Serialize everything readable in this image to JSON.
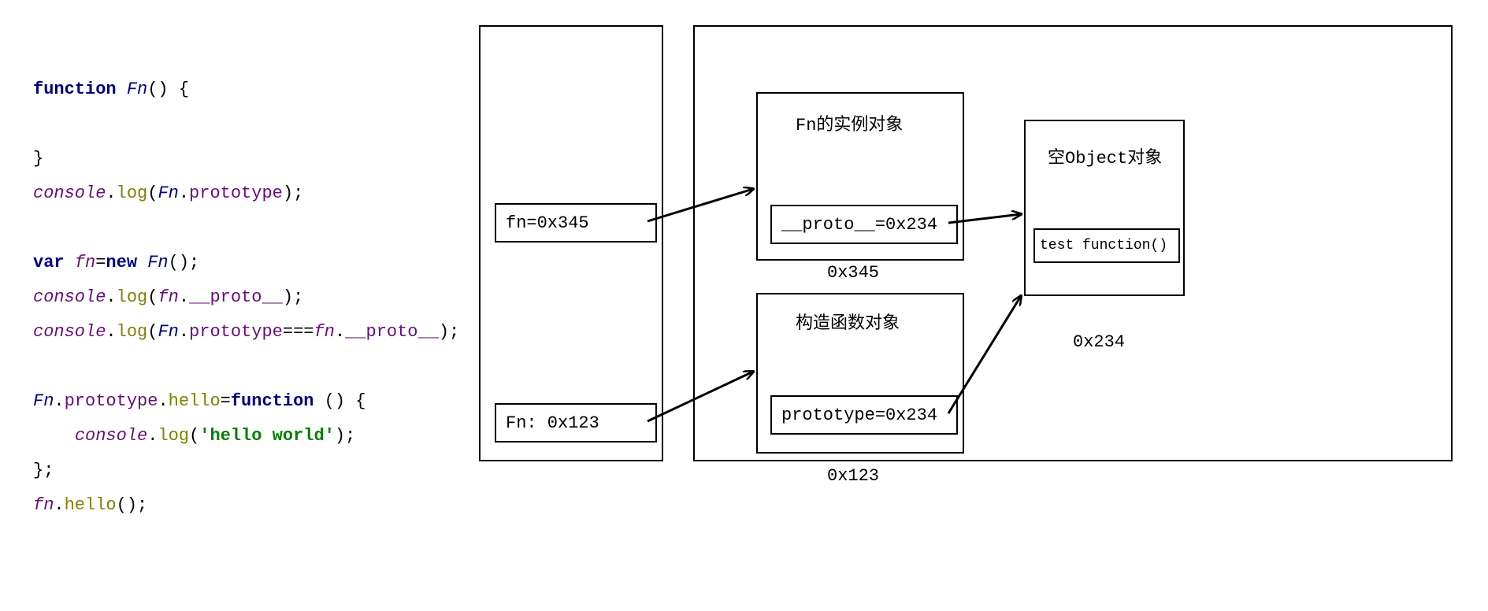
{
  "code": {
    "l1_function": "function",
    "l1_Fn": "Fn",
    "l1_rest": "() {",
    "l2": "",
    "l3_close": "}",
    "l4_console": "console",
    "l4_log": "log",
    "l4_Fn": "Fn",
    "l4_prototype": "prototype",
    "l5": "",
    "l6_var": "var",
    "l6_fn": "fn",
    "l6_new": "new",
    "l6_Fn": "Fn",
    "l7_console": "console",
    "l7_log": "log",
    "l7_fn": "fn",
    "l7_proto": "__proto__",
    "l8_console": "console",
    "l8_log": "log",
    "l8_Fn": "Fn",
    "l8_prototype": "prototype",
    "l8_fn": "fn",
    "l8_proto": "__proto__",
    "l9": "",
    "l10_Fn": "Fn",
    "l10_prototype": "prototype",
    "l10_hello": "hello",
    "l10_function": "function",
    "l10_rest": " () {",
    "l11_console": "console",
    "l11_log": "log",
    "l11_str": "'hello world'",
    "l12_close": "};",
    "l13_fn": "fn",
    "l13_hello": "hello"
  },
  "diagram": {
    "stack_fn": "fn=0x345",
    "stack_Fn": "Fn: 0x123",
    "instance_title": "Fn的实例对象",
    "instance_proto": "__proto__=0x234",
    "instance_addr": "0x345",
    "ctor_title": "构造函数对象",
    "ctor_prototype": "prototype=0x234",
    "ctor_addr": "0x123",
    "empty_obj_title": "空Object对象",
    "empty_obj_test": "test function()",
    "empty_obj_addr": "0x234"
  }
}
